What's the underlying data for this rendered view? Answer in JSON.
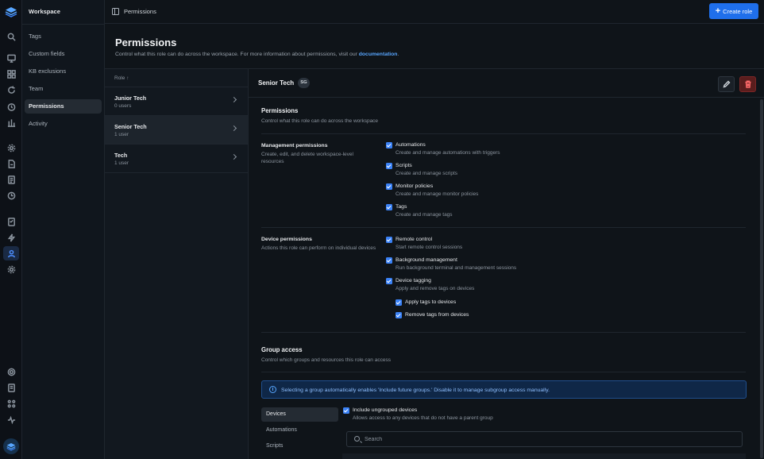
{
  "sidebar": {
    "workspace": "Workspace",
    "items": [
      {
        "label": "Tags"
      },
      {
        "label": "Custom fields"
      },
      {
        "label": "KB exclusions"
      },
      {
        "label": "Team"
      },
      {
        "label": "Permissions",
        "active": true
      },
      {
        "label": "Activity"
      }
    ]
  },
  "header": {
    "breadcrumb": "Permissions",
    "create_button": "Create role",
    "create_icon": "+"
  },
  "page": {
    "title": "Permissions",
    "subtitle": "Control what this role can do across the workspace. For more information about permissions, visit our",
    "link": "documentation",
    "period": "."
  },
  "roles": {
    "header": "Role",
    "sort_icon": "↑",
    "items": [
      {
        "name": "Junior Tech",
        "count": "0 users"
      },
      {
        "name": "Senior Tech",
        "count": "1 user",
        "active": true
      },
      {
        "name": "Tech",
        "count": "1 user"
      }
    ]
  },
  "detail": {
    "role_name": "Senior Tech",
    "badge": "SG",
    "permissions": {
      "title": "Permissions",
      "subtitle": "Control what this role can do across the workspace"
    },
    "management": {
      "label": "Management permissions",
      "desc": "Create, edit, and delete workspace-level resources",
      "items": [
        {
          "name": "Automations",
          "desc": "Create and manage automations with triggers",
          "checked": true
        },
        {
          "name": "Scripts",
          "desc": "Create and manage scripts",
          "checked": true
        },
        {
          "name": "Monitor policies",
          "desc": "Create and manage monitor policies",
          "checked": true
        },
        {
          "name": "Tags",
          "desc": "Create and manage tags",
          "checked": true
        }
      ]
    },
    "device": {
      "label": "Device permissions",
      "desc": "Actions this role can perform on individual devices",
      "items": [
        {
          "name": "Remote control",
          "desc": "Start remote control sessions",
          "checked": true
        },
        {
          "name": "Background management",
          "desc": "Run background terminal and management sessions",
          "checked": true
        },
        {
          "name": "Device tagging",
          "desc": "Apply and remove tags on devices",
          "checked": true
        }
      ],
      "sub_items": [
        {
          "name": "Apply tags to devices",
          "checked": true
        },
        {
          "name": "Remove tags from devices",
          "checked": true
        }
      ]
    },
    "group_access": {
      "title": "Group access",
      "subtitle": "Control which groups and resources this role can access",
      "info": "Selecting a group automatically enables 'Include future groups.' Disable it to manage subgroup access manually.",
      "tabs": [
        "Devices",
        "Automations",
        "Scripts"
      ],
      "include_ungrouped": {
        "name": "Include ungrouped devices",
        "desc": "Allows access to any devices that do not have a parent group",
        "checked": true
      },
      "search_placeholder": "Search"
    }
  },
  "colors": {
    "accent": "#1f6feb",
    "checkbox": "#3b82f6",
    "danger": "#5a1d1d",
    "info_bg": "#0f2747"
  }
}
